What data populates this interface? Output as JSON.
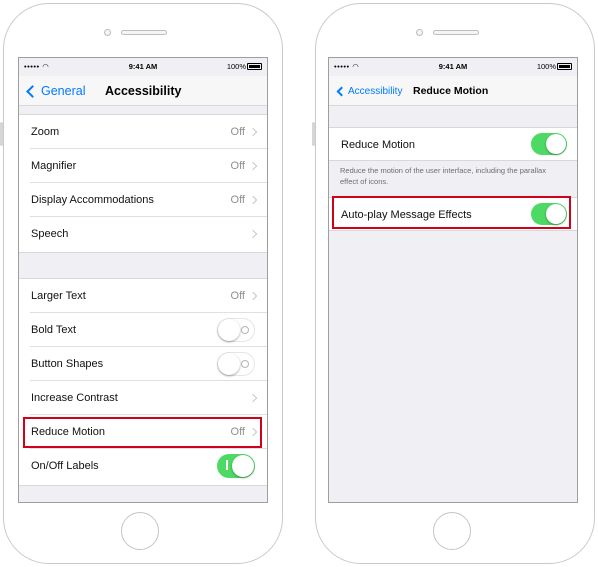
{
  "colors": {
    "accent": "#007aff",
    "toggle_on": "#4cd964",
    "highlight": "#d0021b",
    "background": "#efeff4"
  },
  "left_phone": {
    "status_bar": {
      "carrier": "•••••",
      "time": "9:41 AM",
      "battery": "100%"
    },
    "nav": {
      "back_label": "General",
      "title": "Accessibility"
    },
    "group1": [
      {
        "label": "Zoom",
        "value": "Off"
      },
      {
        "label": "Magnifier",
        "value": "Off"
      },
      {
        "label": "Display Accommodations",
        "value": "Off"
      },
      {
        "label": "Speech",
        "value": ""
      }
    ],
    "group2": [
      {
        "label": "Larger Text",
        "value": "Off"
      },
      {
        "label": "Bold Text",
        "toggle": "off"
      },
      {
        "label": "Button Shapes",
        "toggle": "off"
      },
      {
        "label": "Increase Contrast",
        "value": ""
      },
      {
        "label": "Reduce Motion",
        "value": "Off",
        "highlighted": true
      },
      {
        "label": "On/Off Labels",
        "toggle": "on"
      }
    ]
  },
  "right_phone": {
    "status_bar": {
      "carrier": "•••••",
      "time": "9:41 AM",
      "battery": "100%"
    },
    "nav": {
      "back_label": "Accessibility",
      "title": "Reduce Motion"
    },
    "reduce_motion": {
      "label": "Reduce Motion",
      "toggle": "on"
    },
    "footer": "Reduce the motion of the user interface, including the parallax effect of icons.",
    "auto_play": {
      "label": "Auto-play Message Effects",
      "toggle": "on",
      "highlighted": true
    }
  }
}
